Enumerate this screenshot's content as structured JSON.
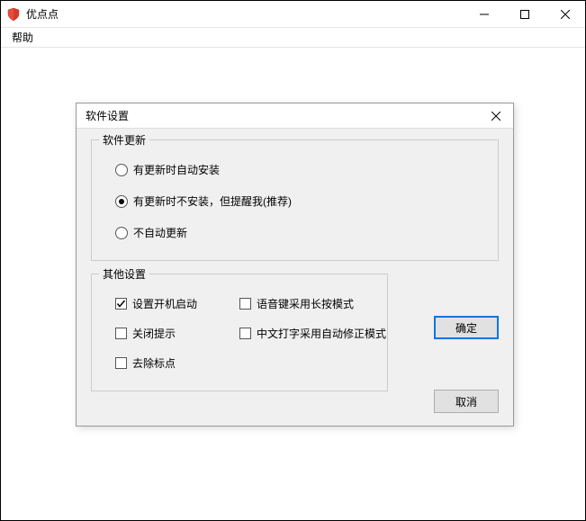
{
  "window": {
    "title": "优点点"
  },
  "menubar": {
    "help": "帮助"
  },
  "dialog": {
    "title": "软件设置",
    "update": {
      "legend": "软件更新",
      "options": [
        {
          "label": "有更新时自动安装",
          "checked": false
        },
        {
          "label": "有更新时不安装，但提醒我(推荐)",
          "checked": true
        },
        {
          "label": "不自动更新",
          "checked": false
        }
      ]
    },
    "other": {
      "legend": "其他设置",
      "checkboxes": [
        {
          "label": "设置开机启动",
          "checked": true
        },
        {
          "label": "语音键采用长按模式",
          "checked": false
        },
        {
          "label": "关闭提示",
          "checked": false
        },
        {
          "label": "中文打字采用自动修正模式",
          "checked": false
        },
        {
          "label": "去除标点",
          "checked": false
        }
      ]
    },
    "buttons": {
      "ok": "确定",
      "cancel": "取消"
    }
  }
}
